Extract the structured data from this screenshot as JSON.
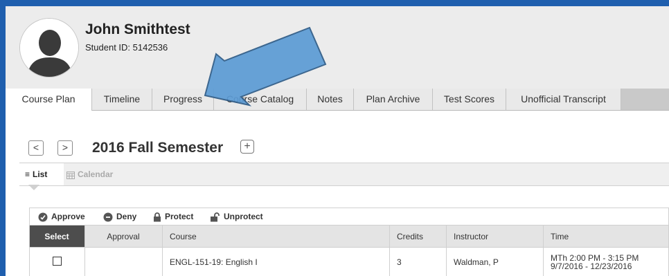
{
  "student": {
    "name": "John Smithtest",
    "id_label": "Student ID: 5142536"
  },
  "tabs": [
    {
      "label": "Course Plan",
      "active": true
    },
    {
      "label": "Timeline",
      "active": false
    },
    {
      "label": "Progress",
      "active": false
    },
    {
      "label": "Course Catalog",
      "active": false
    },
    {
      "label": "Notes",
      "active": false
    },
    {
      "label": "Plan Archive",
      "active": false
    },
    {
      "label": "Test Scores",
      "active": false
    },
    {
      "label": "Unofficial Transcript",
      "active": false
    }
  ],
  "semester": {
    "prev_label": "<",
    "next_label": ">",
    "title": "2016 Fall Semester",
    "add_label": "+"
  },
  "views": {
    "list_label": "List",
    "calendar_label": "Calendar"
  },
  "actions": {
    "approve": "Approve",
    "deny": "Deny",
    "protect": "Protect",
    "unprotect": "Unprotect"
  },
  "table": {
    "headers": [
      "Select",
      "Approval",
      "Course",
      "Credits",
      "Instructor",
      "Time"
    ],
    "rows": [
      {
        "approval": "",
        "course": "ENGL-151-19: English I",
        "credits": "3",
        "instructor": "Waldman, P",
        "time_line1": "MTh 2:00 PM - 3:15 PM",
        "time_line2": "9/7/2016 - 12/23/2016"
      }
    ]
  },
  "colors": {
    "frame": "#1f5fae",
    "arrow_fill": "#5b9bd5",
    "arrow_stroke": "#2e5b87",
    "select_header": "#4d4d4d"
  },
  "icons": [
    "avatar-silhouette-icon",
    "prev-chevron-icon",
    "next-chevron-icon",
    "plus-icon",
    "list-icon",
    "calendar-icon",
    "approve-icon",
    "deny-icon",
    "lock-icon",
    "unlock-icon",
    "annotation-arrow"
  ]
}
